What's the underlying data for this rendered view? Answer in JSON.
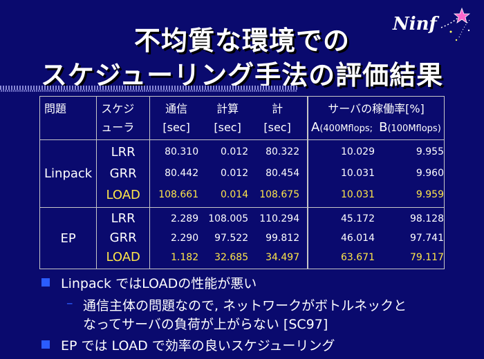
{
  "title": {
    "line1": "不均質な環境での",
    "line2": "スケジューリング手法の評価結果"
  },
  "logo": {
    "text": "Ninf",
    "icon": "sparkle-star-icon"
  },
  "table": {
    "headers": {
      "problem": "問題",
      "scheduler_line1": "スケジ",
      "scheduler_line2": "ューラ",
      "comm": "通信",
      "compute": "計算",
      "total": "計",
      "sec": "[sec]",
      "util": "サーバの稼働率[%]",
      "a_label": "A",
      "a_sub": "(400Mflops;",
      "b_label": "B",
      "b_sub": "(100Mflops)"
    },
    "groups": [
      {
        "problem": "Linpack",
        "rows": [
          {
            "sched": "LRR",
            "comm": "80.310",
            "compute": "0.012",
            "total": "80.322",
            "a": "10.029",
            "b": "9.955"
          },
          {
            "sched": "GRR",
            "comm": "80.442",
            "compute": "0.012",
            "total": "80.454",
            "a": "10.031",
            "b": "9.960"
          },
          {
            "sched": "LOAD",
            "comm": "108.661",
            "compute": "0.014",
            "total": "108.675",
            "a": "10.031",
            "b": "9.959"
          }
        ]
      },
      {
        "problem": "EP",
        "rows": [
          {
            "sched": "LRR",
            "comm": "2.289",
            "compute": "108.005",
            "total": "110.294",
            "a": "45.172",
            "b": "98.128"
          },
          {
            "sched": "GRR",
            "comm": "2.290",
            "compute": "97.522",
            "total": "99.812",
            "a": "46.014",
            "b": "97.741"
          },
          {
            "sched": "LOAD",
            "comm": "1.182",
            "compute": "32.685",
            "total": "34.497",
            "a": "63.671",
            "b": "79.117"
          }
        ]
      }
    ]
  },
  "bullets": {
    "b1": "Linpack ではLOADの性能が悪い",
    "sub1_line1": "通信主体の問題なので, ネットワークがボトルネックと",
    "sub1_line2": "なってサーバの負荷が上がらない [SC97]",
    "dash": "–",
    "b2": "EP では LOAD で効率の良いスケジューリング"
  },
  "colors": {
    "background": "#0a0a6e",
    "highlight": "#ffe64a",
    "bullet": "#2b5cff"
  }
}
